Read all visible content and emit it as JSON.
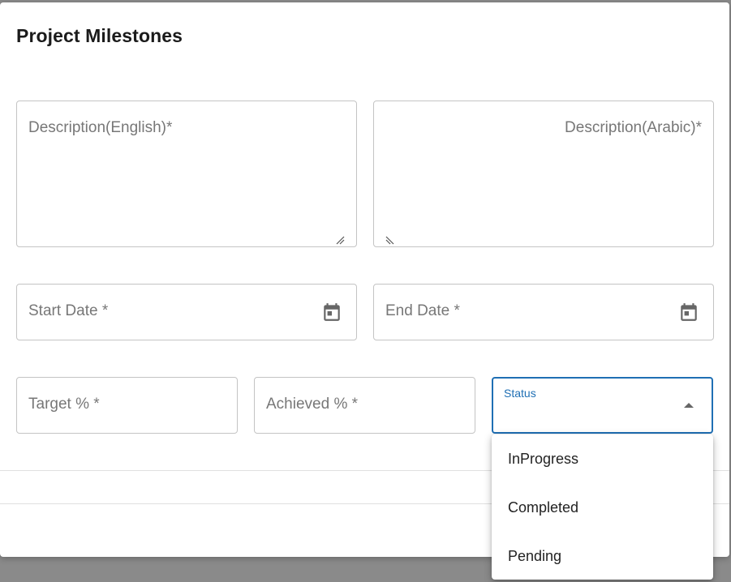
{
  "dialog": {
    "title": "Project Milestones"
  },
  "form": {
    "description_english": {
      "label": "Description(English)*"
    },
    "description_arabic": {
      "label": "Description(Arabic)*"
    },
    "start_date": {
      "label": "Start Date *"
    },
    "end_date": {
      "label": "End Date *"
    },
    "target_percent": {
      "label": "Target % *"
    },
    "achieved_percent": {
      "label": "Achieved % *"
    },
    "status": {
      "label": "Status",
      "options": [
        "InProgress",
        "Completed",
        "Pending"
      ]
    }
  },
  "colors": {
    "accent": "#1f6fb4",
    "border": "#c4c4c4",
    "label": "#777777",
    "backdrop": "#8a8a8a"
  },
  "icons": {
    "calendar": "calendar-icon",
    "caret": "caret-up-icon",
    "resize": "resize-handle-icon"
  }
}
